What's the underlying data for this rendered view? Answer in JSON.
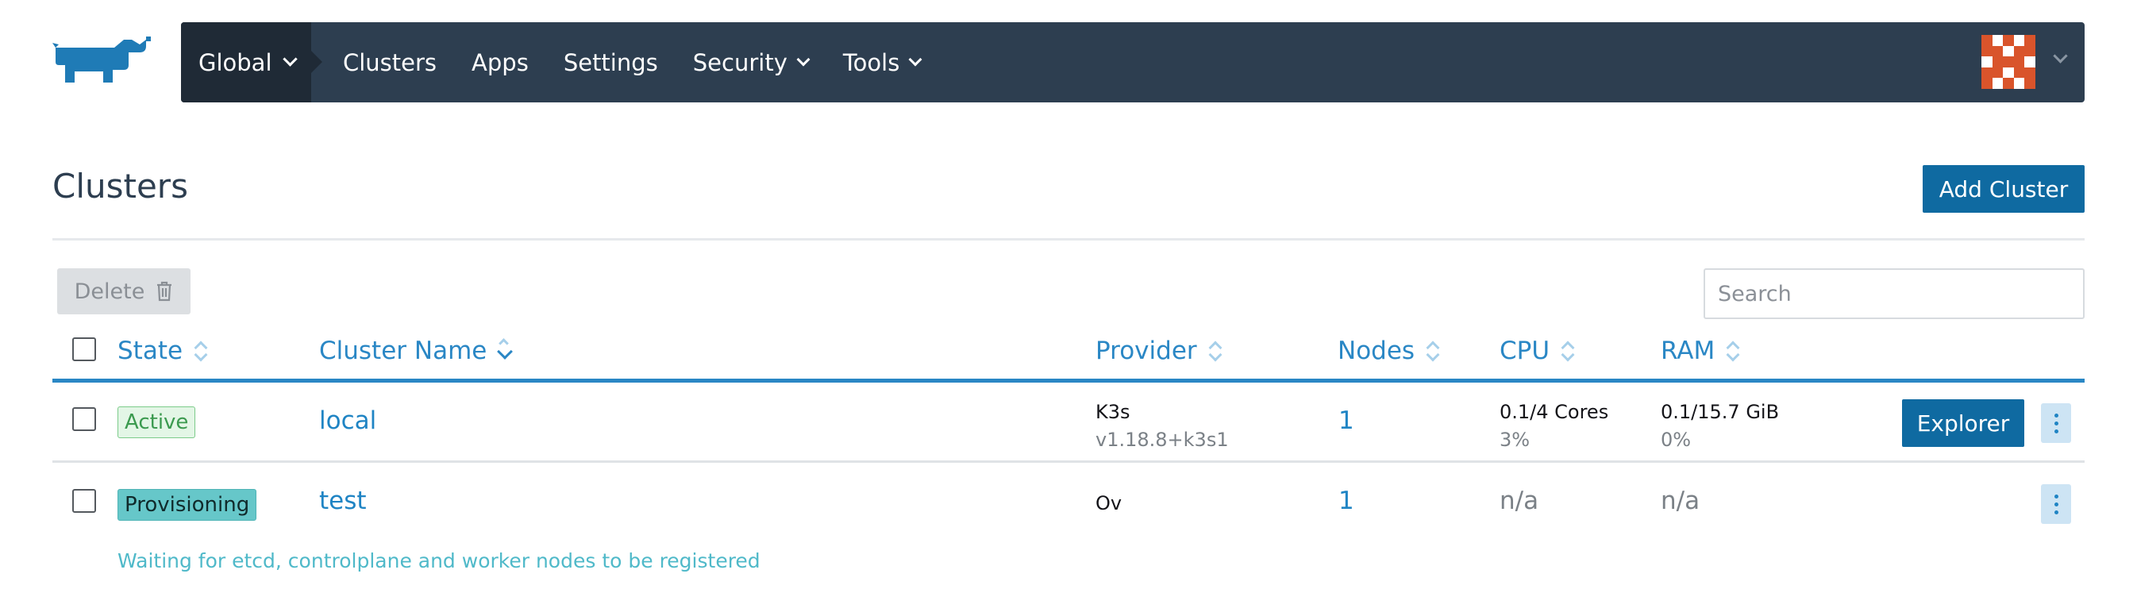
{
  "nav": {
    "global": "Global",
    "items": [
      "Clusters",
      "Apps",
      "Settings",
      "Security",
      "Tools"
    ]
  },
  "page": {
    "title": "Clusters",
    "add_button": "Add Cluster"
  },
  "toolbar": {
    "delete_label": "Delete",
    "search_placeholder": "Search"
  },
  "table": {
    "columns": [
      "State",
      "Cluster Name",
      "Provider",
      "Nodes",
      "CPU",
      "RAM"
    ],
    "rows": [
      {
        "state": "Active",
        "name": "local",
        "provider": "K3s",
        "provider_version": "v1.18.8+k3s1",
        "nodes": "1",
        "cpu": "0.1/4 Cores",
        "cpu_pct": "3%",
        "ram": "0.1/15.7 GiB",
        "ram_pct": "0%",
        "action": "Explorer"
      },
      {
        "state": "Provisioning",
        "name": "test",
        "provider": "Ov",
        "nodes": "1",
        "cpu": "n/a",
        "ram": "n/a",
        "message": "Waiting for etcd, controlplane and worker nodes to be registered"
      }
    ]
  },
  "colors": {
    "nav_bg": "#2d3e50",
    "nav_active_bg": "#1f2a36",
    "primary": "#0f6aa1",
    "link": "#1f84c4",
    "active_badge": "#e3f6e6",
    "provisioning_badge": "#66c7c9",
    "avatar": "#d9542b"
  }
}
